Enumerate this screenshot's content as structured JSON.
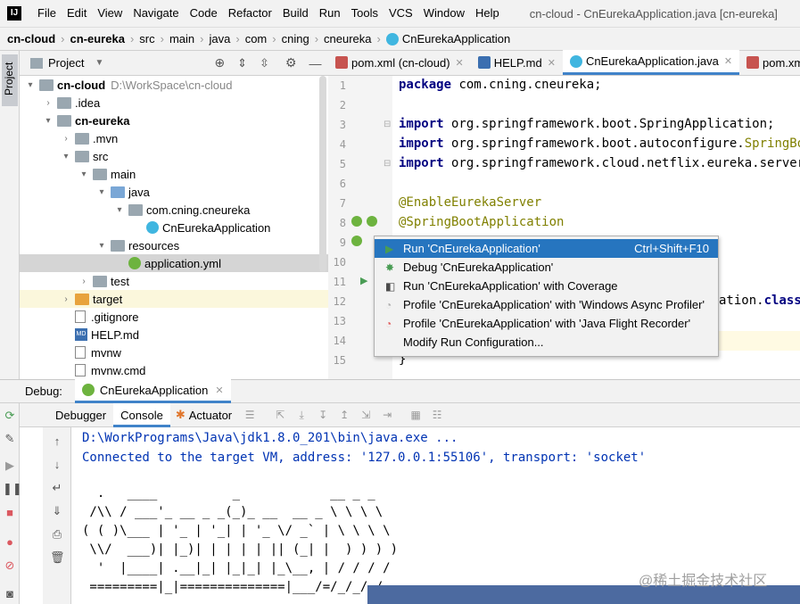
{
  "menubar": {
    "items": [
      "File",
      "Edit",
      "View",
      "Navigate",
      "Code",
      "Refactor",
      "Build",
      "Run",
      "Tools",
      "VCS",
      "Window",
      "Help"
    ],
    "window_title": "cn-cloud - CnEurekaApplication.java [cn-eureka]"
  },
  "breadcrumb": [
    "cn-cloud",
    "cn-eureka",
    "src",
    "main",
    "java",
    "com",
    "cning",
    "cneureka",
    "CnEurekaApplication"
  ],
  "stripe": {
    "project": "Project"
  },
  "project_panel": {
    "title": "Project",
    "tree": [
      {
        "label": "cn-cloud",
        "hint": "D:\\WorkSpace\\cn-cloud",
        "bold": true,
        "arrow": "▾",
        "icon": "folder"
      },
      {
        "label": ".idea",
        "arrow": "›",
        "icon": "folder"
      },
      {
        "label": "cn-eureka",
        "bold": true,
        "arrow": "▾",
        "icon": "folder"
      },
      {
        "label": ".mvn",
        "arrow": "›",
        "icon": "folder"
      },
      {
        "label": "src",
        "arrow": "▾",
        "icon": "folder"
      },
      {
        "label": "main",
        "arrow": "▾",
        "icon": "folder"
      },
      {
        "label": "java",
        "arrow": "▾",
        "icon": "folder-blue"
      },
      {
        "label": "com.cning.cneureka",
        "arrow": "▾",
        "icon": "package"
      },
      {
        "label": "CnEurekaApplication",
        "arrow": "",
        "icon": "class"
      },
      {
        "label": "resources",
        "arrow": "▾",
        "icon": "folder"
      },
      {
        "label": "application.yml",
        "arrow": "",
        "icon": "yml"
      },
      {
        "label": "test",
        "arrow": "›",
        "icon": "folder"
      },
      {
        "label": "target",
        "arrow": "›",
        "icon": "folder-orange"
      },
      {
        "label": ".gitignore",
        "arrow": "",
        "icon": "txt"
      },
      {
        "label": "HELP.md",
        "arrow": "",
        "icon": "md"
      },
      {
        "label": "mvnw",
        "arrow": "",
        "icon": "txt"
      },
      {
        "label": "mvnw.cmd",
        "arrow": "",
        "icon": "txt"
      }
    ]
  },
  "editor": {
    "tabs": [
      {
        "label": "pom.xml (cn-cloud)",
        "icon": "maven-icon"
      },
      {
        "label": "HELP.md",
        "icon": "md-icon"
      },
      {
        "label": "CnEurekaApplication.java",
        "icon": "class-icon",
        "active": true
      },
      {
        "label": "pom.xml",
        "icon": "maven-icon"
      }
    ],
    "line_numbers": [
      "1",
      "2",
      "3",
      "4",
      "5",
      "6",
      "7",
      "8",
      "9",
      "10",
      "11",
      "12",
      "13",
      "14",
      "15"
    ],
    "lines": [
      {
        "kw": "package",
        "rest": " com.cning.cneureka;"
      },
      {
        "kw": "",
        "rest": ""
      },
      {
        "kw": "import",
        "rest": " org.springframework.boot.SpringApplication;"
      },
      {
        "kw": "import",
        "rest": " org.springframework.boot.autoconfigure.SpringBoota"
      },
      {
        "kw": "import",
        "rest": " org.springframework.cloud.netflix.eureka.server.Er"
      },
      {
        "kw": "",
        "rest": ""
      },
      {
        "ann": "@EnableEurekaServer"
      },
      {
        "ann": "@SpringBootApplication"
      },
      {
        "kw": "",
        "rest": ""
      },
      {
        "kw": "",
        "rest": ""
      },
      {
        "kw": "",
        "rest": ""
      },
      {
        "kw": "",
        "rest": "ation.class,"
      },
      {
        "kw": "",
        "rest": ""
      },
      {
        "kw": "",
        "rest": ""
      },
      {
        "kw": "",
        "rest": "}"
      }
    ]
  },
  "popup": {
    "items": [
      {
        "label": "Run 'CnEurekaApplication'",
        "shortcut": "Ctrl+Shift+F10",
        "icon": "run-icon"
      },
      {
        "label": "Debug 'CnEurekaApplication'",
        "shortcut": "",
        "icon": "debug-icon"
      },
      {
        "label": "Run 'CnEurekaApplication' with Coverage",
        "shortcut": "",
        "icon": "coverage-icon"
      },
      {
        "label": "Profile 'CnEurekaApplication' with 'Windows Async Profiler'",
        "shortcut": "",
        "icon": "profiler-icon"
      },
      {
        "label": "Profile 'CnEurekaApplication' with 'Java Flight Recorder'",
        "shortcut": "",
        "icon": "jfr-icon"
      },
      {
        "label": "Modify Run Configuration...",
        "shortcut": "",
        "icon": ""
      }
    ]
  },
  "debug": {
    "label": "Debug:",
    "config": "CnEurekaApplication",
    "tabs": [
      "Debugger",
      "Console",
      "Actuator"
    ],
    "console_lines": [
      "D:\\WorkPrograms\\Java\\jdk1.8.0_201\\bin\\java.exe ...",
      "Connected to the target VM, address: '127.0.0.1:55106', transport: 'socket'",
      "",
      "  .   ____          _            __ _ _",
      " /\\\\ / ___'_ __ _ _(_)_ __  __ _ \\ \\ \\ \\",
      "( ( )\\___ | '_ | '_| | '_ \\/ _` | \\ \\ \\ \\",
      " \\\\/  ___)| |_)| | | | | || (_| |  ) ) ) )",
      "  '  |____| .__|_| |_|_| |_\\__, | / / / /",
      " =========|_|==============|___/=/_/_/_/"
    ]
  },
  "watermark": "@稀土掘金技术社区",
  "colors": {
    "accent": "#4083c9",
    "selection": "#2675bf",
    "keyword": "#000080",
    "annotation": "#808000"
  }
}
